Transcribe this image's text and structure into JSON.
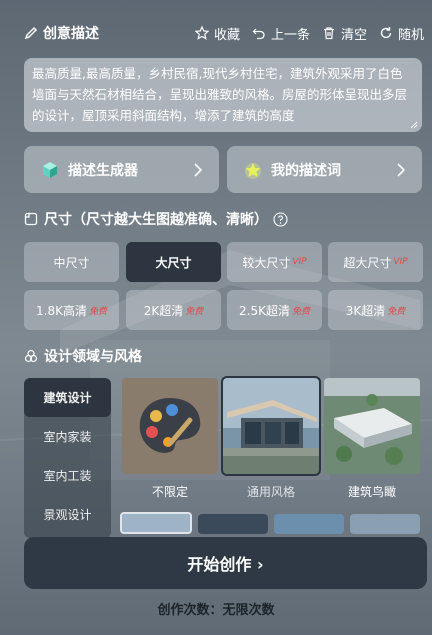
{
  "header": {
    "title": "创意描述",
    "actions": [
      {
        "label": "收藏",
        "icon": "star-icon"
      },
      {
        "label": "上一条",
        "icon": "undo-icon"
      },
      {
        "label": "清空",
        "icon": "trash-icon"
      },
      {
        "label": "随机",
        "icon": "refresh-icon"
      }
    ]
  },
  "description": {
    "value": "最高质量,最高质量，乡村民宿,现代乡村住宅，建筑外观采用了白色墙面与天然石材相结合，呈现出雅致的风格。房屋的形体呈现出多层的设计，屋顶采用斜面结构，增添了建筑的高度"
  },
  "generators": {
    "desc_generator": "描述生成器",
    "my_desc": "我的描述词"
  },
  "size_section": {
    "title": "尺寸（尺寸越大生图越准确、清晰）",
    "sizes": [
      {
        "label": "中尺寸",
        "badge": ""
      },
      {
        "label": "大尺寸",
        "badge": ""
      },
      {
        "label": "较大尺寸",
        "badge": "VIP"
      },
      {
        "label": "超大尺寸",
        "badge": "VIP"
      }
    ],
    "resolutions": [
      {
        "label": "1.8K高清",
        "badge": "免费"
      },
      {
        "label": "2K超清",
        "badge": "免费"
      },
      {
        "label": "2.5K超清",
        "badge": "免费"
      },
      {
        "label": "3K超清",
        "badge": "免费"
      }
    ],
    "selected": "大尺寸"
  },
  "style_section": {
    "title": "设计领域与风格",
    "categories": [
      "建筑设计",
      "室内家装",
      "室内工装",
      "景观设计"
    ],
    "selected_category": "建筑设计",
    "styles": [
      {
        "label": "不限定",
        "icon": "palette-icon"
      },
      {
        "label": "通用风格",
        "icon": "modern-house-image"
      },
      {
        "label": "建筑鸟瞰",
        "icon": "aerial-view-image"
      }
    ],
    "selected_style": "通用风格"
  },
  "start_button": "开始创作 ›",
  "usage": "创作次数：无限次数",
  "colors": {
    "accent_dark": "#2c3540",
    "vip_red": "#e04a4a"
  }
}
